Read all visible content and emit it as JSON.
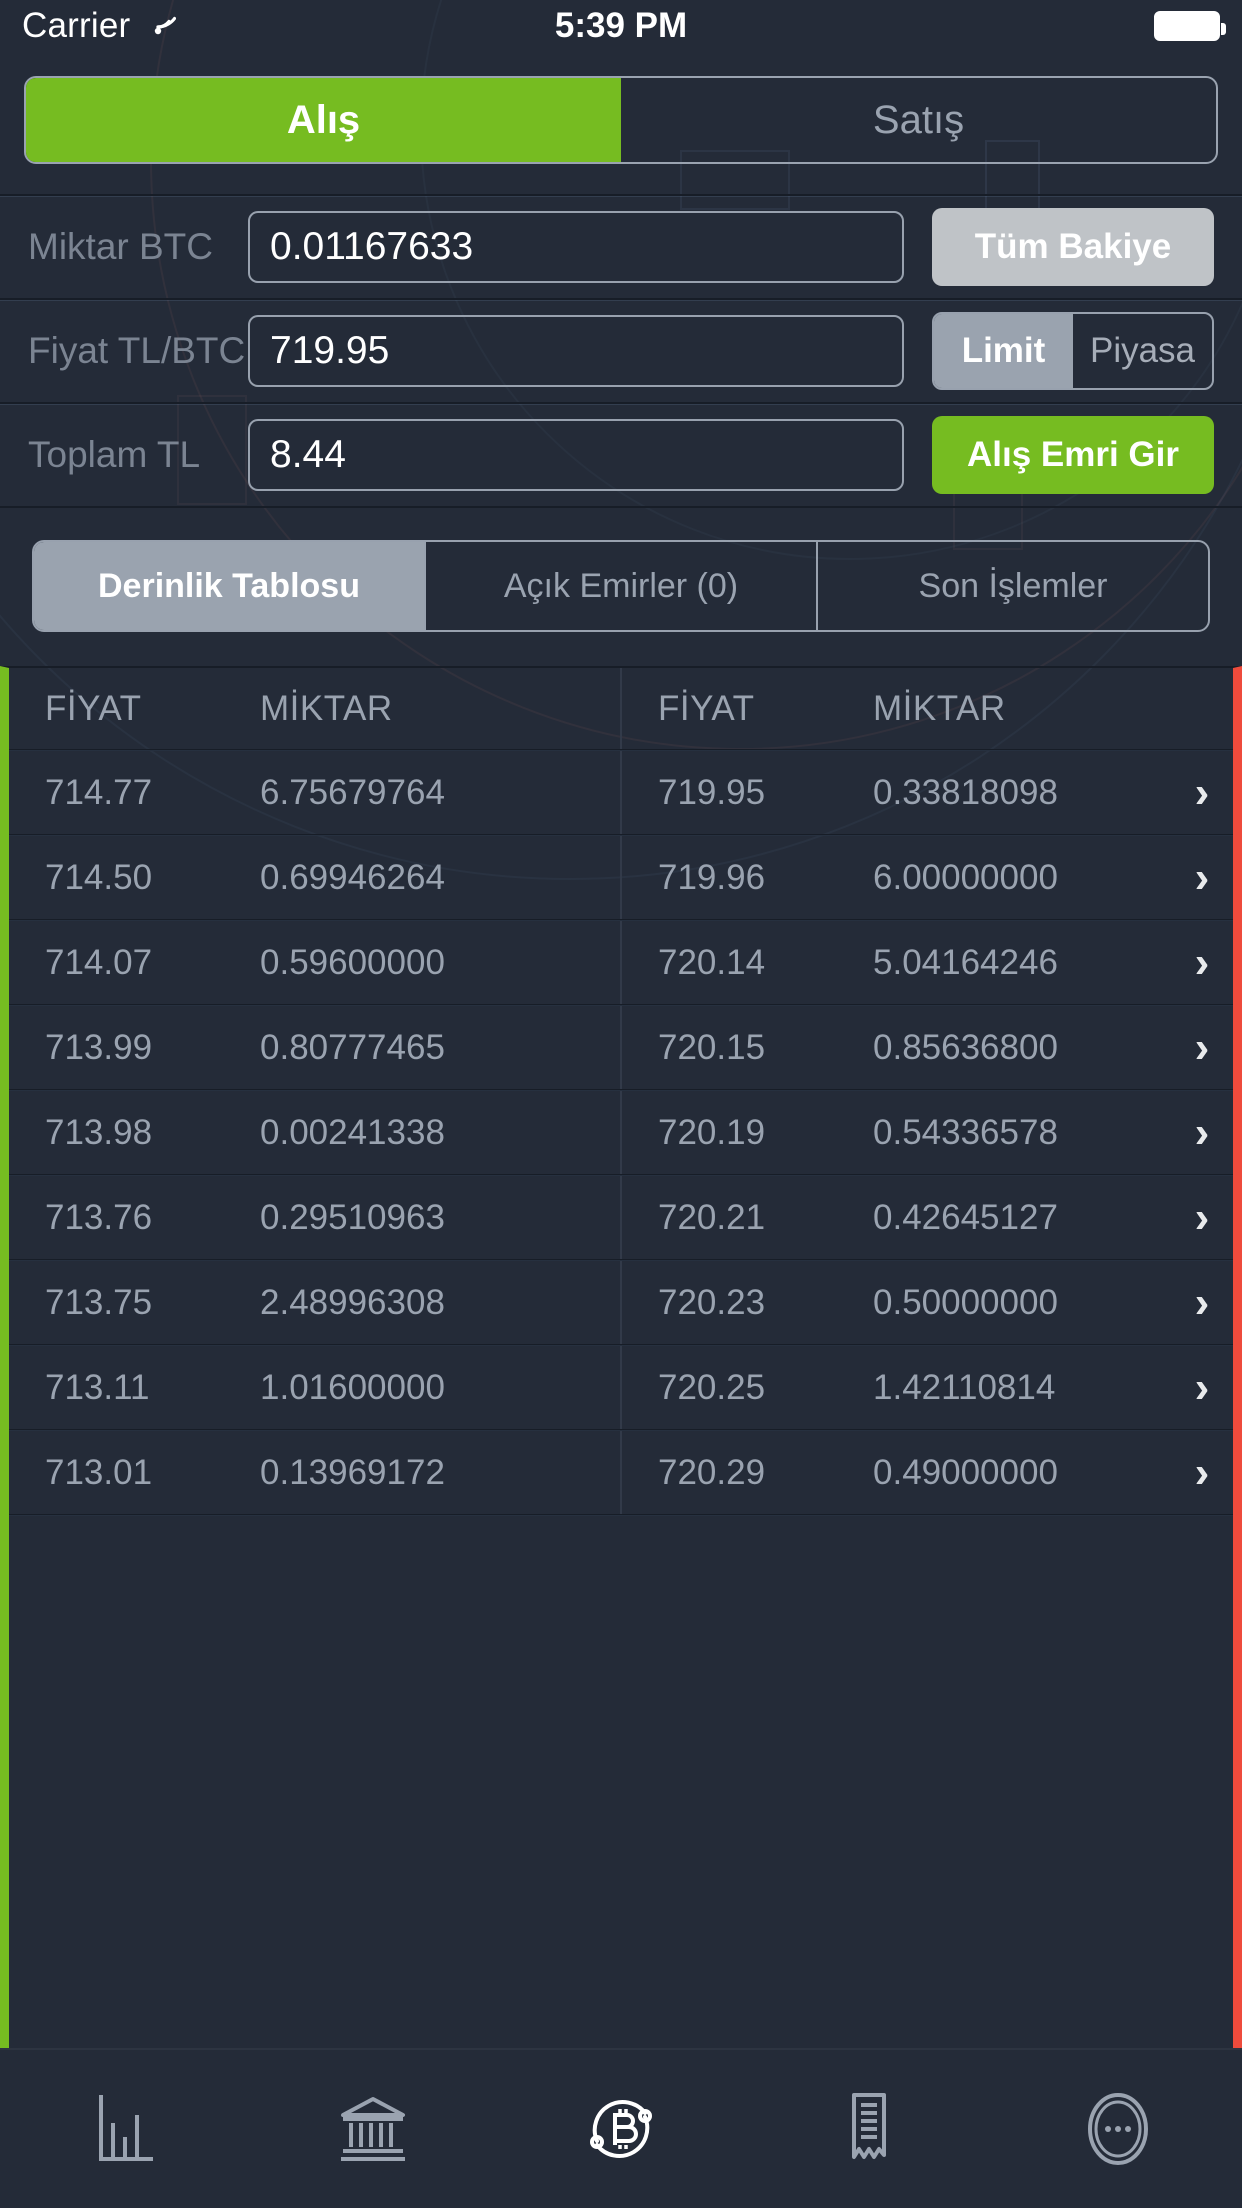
{
  "statusbar": {
    "carrier": "Carrier",
    "wifi_icon": "wifi-icon",
    "time": "5:39 PM",
    "battery_icon": "battery-full-icon"
  },
  "side_tabs": {
    "buy_label": "Alış",
    "sell_label": "Satış",
    "active": "buy",
    "active_color": "#76bc21"
  },
  "order_form": {
    "amount": {
      "label": "Miktar BTC",
      "value": "0.01167633",
      "placeholder": "0.00000000",
      "action_label": "Tüm Bakiye"
    },
    "price": {
      "label": "Fiyat TL/BTC",
      "value": "719.95",
      "placeholder": "0.00",
      "type_limit_label": "Limit",
      "type_market_label": "Piyasa",
      "type_active": "Limit"
    },
    "total": {
      "label": "Toplam TL",
      "value": "8.44",
      "placeholder": "0.00",
      "submit_label": "Alış Emri Gir"
    }
  },
  "list_tabs": {
    "items": [
      {
        "label": "Derinlik Tablosu",
        "active": true
      },
      {
        "label": "Açık Emirler (0)",
        "active": false
      },
      {
        "label": "Son İşlemler",
        "active": false
      }
    ]
  },
  "order_book": {
    "bid_headers": {
      "price": "FİYAT",
      "amount": "MİKTAR",
      "color": "#76bc21"
    },
    "ask_headers": {
      "price": "FİYAT",
      "amount": "MİKTAR",
      "color": "#ee4b3c"
    },
    "rows": [
      {
        "bid_price": "714.77",
        "bid_amount": "6.75679764",
        "ask_price": "719.95",
        "ask_amount": "0.33818098"
      },
      {
        "bid_price": "714.50",
        "bid_amount": "0.69946264",
        "ask_price": "719.96",
        "ask_amount": "6.00000000"
      },
      {
        "bid_price": "714.07",
        "bid_amount": "0.59600000",
        "ask_price": "720.14",
        "ask_amount": "5.04164246"
      },
      {
        "bid_price": "713.99",
        "bid_amount": "0.80777465",
        "ask_price": "720.15",
        "ask_amount": "0.85636800"
      },
      {
        "bid_price": "713.98",
        "bid_amount": "0.00241338",
        "ask_price": "720.19",
        "ask_amount": "0.54336578"
      },
      {
        "bid_price": "713.76",
        "bid_amount": "0.29510963",
        "ask_price": "720.21",
        "ask_amount": "0.42645127"
      },
      {
        "bid_price": "713.75",
        "bid_amount": "2.48996308",
        "ask_price": "720.23",
        "ask_amount": "0.50000000"
      },
      {
        "bid_price": "713.11",
        "bid_amount": "1.01600000",
        "ask_price": "720.25",
        "ask_amount": "1.42110814"
      },
      {
        "bid_price": "713.01",
        "bid_amount": "0.13969172",
        "ask_price": "720.29",
        "ask_amount": "0.49000000"
      }
    ],
    "row_chevron_icon": "chevron-right-icon"
  },
  "tabbar": {
    "items": [
      {
        "icon": "bar-chart-icon",
        "active": false
      },
      {
        "icon": "bank-icon",
        "active": false
      },
      {
        "icon": "bitcoin-exchange-icon",
        "active": true
      },
      {
        "icon": "receipt-icon",
        "active": false
      },
      {
        "icon": "more-coin-icon",
        "active": false
      }
    ]
  }
}
